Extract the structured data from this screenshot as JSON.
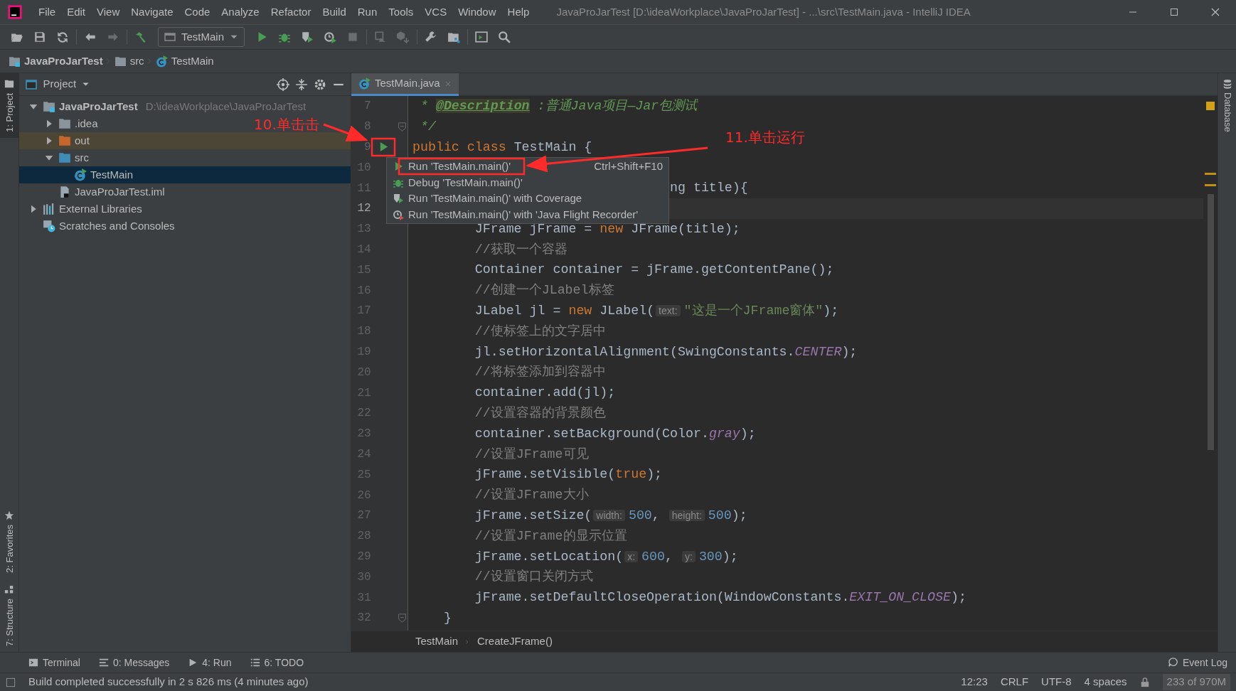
{
  "window": {
    "title": "JavaProJarTest [D:\\ideaWorkplace\\JavaProJarTest] - ...\\src\\TestMain.java - IntelliJ IDEA",
    "menu": [
      "File",
      "Edit",
      "View",
      "Navigate",
      "Code",
      "Analyze",
      "Refactor",
      "Build",
      "Run",
      "Tools",
      "VCS",
      "Window",
      "Help"
    ]
  },
  "toolbar": {
    "items": [
      {
        "kind": "open",
        "disabled": false
      },
      {
        "kind": "save",
        "disabled": false
      },
      {
        "kind": "sync",
        "disabled": false
      },
      {
        "kind": "sep"
      },
      {
        "kind": "back",
        "disabled": false
      },
      {
        "kind": "forward",
        "disabled": true
      },
      {
        "kind": "sep"
      },
      {
        "kind": "build",
        "disabled": false
      },
      {
        "kind": "config"
      },
      {
        "kind": "run",
        "disabled": false
      },
      {
        "kind": "debug",
        "disabled": false
      },
      {
        "kind": "coverage",
        "disabled": false
      },
      {
        "kind": "profile",
        "disabled": false
      },
      {
        "kind": "stop",
        "disabled": true
      },
      {
        "kind": "sep"
      },
      {
        "kind": "attach",
        "disabled": true
      },
      {
        "kind": "deploy",
        "disabled": true
      },
      {
        "kind": "sep"
      },
      {
        "kind": "wrench",
        "disabled": false
      },
      {
        "kind": "structure",
        "disabled": false
      },
      {
        "kind": "sep"
      },
      {
        "kind": "terminal",
        "disabled": false
      },
      {
        "kind": "search",
        "disabled": false
      }
    ],
    "run_config": "TestMain"
  },
  "nav_bar": [
    {
      "label": "JavaProJarTest",
      "kind": "project"
    },
    {
      "label": "src",
      "kind": "folder"
    },
    {
      "label": "TestMain",
      "kind": "class"
    }
  ],
  "left_stripe": [
    {
      "label": "1: Project",
      "selected": true,
      "kind": "project"
    },
    {
      "label": "2: Favorites",
      "selected": false,
      "kind": "favorites"
    },
    {
      "label": "7: Structure",
      "selected": false,
      "kind": "structure"
    }
  ],
  "project_panel": {
    "title": "Project",
    "tree": [
      {
        "label": "JavaProJarTest",
        "hint": "D:\\ideaWorkplace\\JavaProJarTest",
        "kind": "project",
        "expanded": true,
        "selected": false,
        "highlighted": false,
        "children": [
          {
            "label": ".idea",
            "kind": "folder",
            "expanded": false,
            "selected": false,
            "highlighted": false
          },
          {
            "label": "out",
            "kind": "excluded",
            "expanded": false,
            "selected": false,
            "highlighted": true
          },
          {
            "label": "src",
            "kind": "source",
            "expanded": true,
            "selected": false,
            "highlighted": false,
            "children": [
              {
                "label": "TestMain",
                "kind": "class",
                "selected": true,
                "highlighted": false
              }
            ]
          },
          {
            "label": "JavaProJarTest.iml",
            "kind": "file",
            "selected": false,
            "highlighted": false
          }
        ]
      },
      {
        "label": "External Libraries",
        "kind": "libraries",
        "expanded": false,
        "selected": false,
        "highlighted": false
      },
      {
        "label": "Scratches and Consoles",
        "kind": "scratches",
        "selected": false,
        "highlighted": false
      }
    ]
  },
  "editor": {
    "tabs": [
      {
        "label": "TestMain.java",
        "selected": true
      }
    ],
    "lines": [
      {
        "number": "7",
        "current": false,
        "kind": "plain",
        "code": [
          {
            "text": " * ",
            "kind": "doc"
          },
          {
            "text": "@Description",
            "kind": "doctag"
          },
          {
            "text": " :普通Java项目—Jar包测试",
            "kind": "doc"
          }
        ]
      },
      {
        "number": "8",
        "current": false,
        "kind": "fold",
        "code": [
          {
            "text": " */",
            "kind": "doc"
          }
        ]
      },
      {
        "number": "9",
        "current": false,
        "kind": "run",
        "code": [
          {
            "text": "public",
            "kind": "kw"
          },
          {
            "text": " class",
            "kind": "kw"
          },
          {
            "text": " TestMain {",
            "kind": "plain"
          }
        ]
      },
      {
        "number": "10",
        "current": false,
        "kind": "plain"
      },
      {
        "number": "11",
        "current": false,
        "kind": "covered",
        "code": [
          {
            "text": "ng title){",
            "kind": "plain"
          }
        ]
      },
      {
        "number": "12",
        "current": true,
        "kind": "plain"
      },
      {
        "number": "13",
        "current": false,
        "kind": "plain",
        "code": [
          {
            "text": "        JFrame jFrame = ",
            "kind": "plain"
          },
          {
            "text": "new",
            "kind": "kw"
          },
          {
            "text": " JFrame(title);",
            "kind": "plain"
          }
        ]
      },
      {
        "number": "14",
        "current": false,
        "kind": "plain",
        "code": [
          {
            "text": "        //获取一个容器",
            "kind": "comment"
          }
        ]
      },
      {
        "number": "15",
        "current": false,
        "kind": "plain",
        "code": [
          {
            "text": "        Container container = jFrame.getContentPane();",
            "kind": "plain"
          }
        ]
      },
      {
        "number": "16",
        "current": false,
        "kind": "plain",
        "code": [
          {
            "text": "        //创建一个JLabel标签",
            "kind": "comment"
          }
        ]
      },
      {
        "number": "17",
        "current": false,
        "kind": "plain",
        "code": [
          {
            "text": "        JLabel jl = ",
            "kind": "plain"
          },
          {
            "text": "new",
            "kind": "kw"
          },
          {
            "text": " JLabel(",
            "kind": "plain"
          },
          {
            "text": "text:",
            "kind": "hint"
          },
          {
            "text": "\"这是一个JFrame窗体\"",
            "kind": "str"
          },
          {
            "text": ");",
            "kind": "plain"
          }
        ]
      },
      {
        "number": "18",
        "current": false,
        "kind": "plain",
        "code": [
          {
            "text": "        //使标签上的文字居中",
            "kind": "comment"
          }
        ]
      },
      {
        "number": "19",
        "current": false,
        "kind": "plain",
        "code": [
          {
            "text": "        jl.setHorizontalAlignment(SwingConstants.",
            "kind": "plain"
          },
          {
            "text": "CENTER",
            "kind": "const"
          },
          {
            "text": ");",
            "kind": "plain"
          }
        ]
      },
      {
        "number": "20",
        "current": false,
        "kind": "plain",
        "code": [
          {
            "text": "        //将标签添加到容器中",
            "kind": "comment"
          }
        ]
      },
      {
        "number": "21",
        "current": false,
        "kind": "plain",
        "code": [
          {
            "text": "        container.add(jl);",
            "kind": "plain"
          }
        ]
      },
      {
        "number": "22",
        "current": false,
        "kind": "plain",
        "code": [
          {
            "text": "        //设置容器的背景颜色",
            "kind": "comment"
          }
        ]
      },
      {
        "number": "23",
        "current": false,
        "kind": "plain",
        "code": [
          {
            "text": "        container.setBackground(Color.",
            "kind": "plain"
          },
          {
            "text": "gray",
            "kind": "const"
          },
          {
            "text": ");",
            "kind": "plain"
          }
        ]
      },
      {
        "number": "24",
        "current": false,
        "kind": "plain",
        "code": [
          {
            "text": "        //设置JFrame可见",
            "kind": "comment"
          }
        ]
      },
      {
        "number": "25",
        "current": false,
        "kind": "plain",
        "code": [
          {
            "text": "        jFrame.setVisible(",
            "kind": "plain"
          },
          {
            "text": "true",
            "kind": "kw"
          },
          {
            "text": ");",
            "kind": "plain"
          }
        ]
      },
      {
        "number": "26",
        "current": false,
        "kind": "plain",
        "code": [
          {
            "text": "        //设置JFrame大小",
            "kind": "comment"
          }
        ]
      },
      {
        "number": "27",
        "current": false,
        "kind": "plain",
        "code": [
          {
            "text": "        jFrame.setSize(",
            "kind": "plain"
          },
          {
            "text": "width:",
            "kind": "hint"
          },
          {
            "text": "500",
            "kind": "num"
          },
          {
            "text": ", ",
            "kind": "plain"
          },
          {
            "text": "height:",
            "kind": "hint"
          },
          {
            "text": "500",
            "kind": "num"
          },
          {
            "text": ");",
            "kind": "plain"
          }
        ]
      },
      {
        "number": "28",
        "current": false,
        "kind": "plain",
        "code": [
          {
            "text": "        //设置JFrame的显示位置",
            "kind": "comment"
          }
        ]
      },
      {
        "number": "29",
        "current": false,
        "kind": "plain",
        "code": [
          {
            "text": "        jFrame.setLocation(",
            "kind": "plain"
          },
          {
            "text": "x:",
            "kind": "hint"
          },
          {
            "text": "600",
            "kind": "num"
          },
          {
            "text": ", ",
            "kind": "plain"
          },
          {
            "text": "y:",
            "kind": "hint"
          },
          {
            "text": "300",
            "kind": "num"
          },
          {
            "text": ");",
            "kind": "plain"
          }
        ]
      },
      {
        "number": "30",
        "current": false,
        "kind": "plain",
        "code": [
          {
            "text": "        //设置窗口关闭方式",
            "kind": "comment"
          }
        ]
      },
      {
        "number": "31",
        "current": false,
        "kind": "plain",
        "code": [
          {
            "text": "        jFrame.setDefaultCloseOperation(WindowConstants.",
            "kind": "plain"
          },
          {
            "text": "EXIT_ON_CLOSE",
            "kind": "const"
          },
          {
            "text": ");",
            "kind": "plain"
          }
        ]
      },
      {
        "number": "32",
        "current": false,
        "kind": "fold",
        "code": [
          {
            "text": "    }",
            "kind": "plain"
          }
        ]
      }
    ],
    "popup": [
      {
        "label": "Run 'TestMain.main()'",
        "shortcut": "Ctrl+Shift+F10",
        "kind": "run"
      },
      {
        "label": "Debug 'TestMain.main()'",
        "kind": "debug"
      },
      {
        "label": "Run 'TestMain.main()' with Coverage",
        "kind": "coverage"
      },
      {
        "label": "Run 'TestMain.main()' with 'Java Flight Recorder'",
        "kind": "profile"
      }
    ],
    "breadcrumb": [
      "TestMain",
      "CreateJFrame()"
    ]
  },
  "right_stripe": [
    {
      "label": "Database"
    }
  ],
  "annotations": [
    {
      "text": "10.单击击"
    },
    {
      "text": "11.单击运行"
    }
  ],
  "tool_tabs": [
    {
      "label": "Terminal",
      "kind": "terminal"
    },
    {
      "label": "0: Messages",
      "kind": "messages"
    },
    {
      "label": "4: Run",
      "kind": "run"
    },
    {
      "label": "6: TODO",
      "kind": "todo"
    }
  ],
  "event_log": "Event Log",
  "status_bar": {
    "message": "Build completed successfully in 2 s 826 ms (4 minutes ago)",
    "items": [
      "12:23",
      "CRLF",
      "UTF-8",
      "4 spaces"
    ],
    "memory": "233 of 970M"
  }
}
